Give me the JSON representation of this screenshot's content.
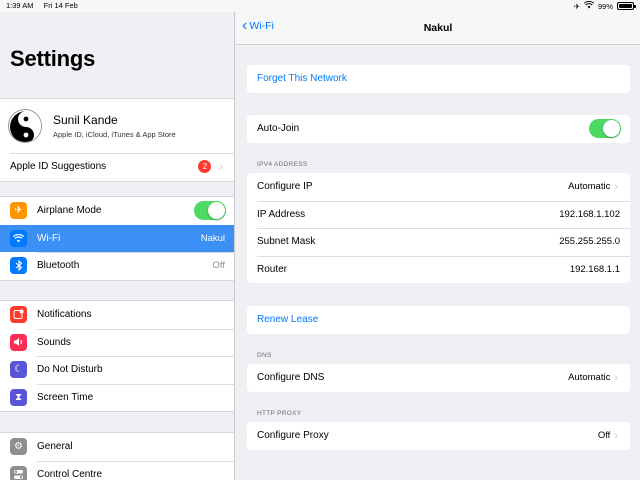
{
  "status": {
    "time": "1:39 AM",
    "date": "Fri 14 Feb",
    "battery": "99%"
  },
  "left": {
    "title": "Settings",
    "profile": {
      "name": "Sunil Kande",
      "subtitle": "Apple ID, iCloud, iTunes & App Store"
    },
    "suggestions": {
      "label": "Apple ID Suggestions",
      "badge": "2"
    },
    "connectivity": [
      {
        "label": "Airplane Mode",
        "icon": "airplane-icon",
        "color": "#ff9500"
      },
      {
        "label": "Wi-Fi",
        "value": "Nakul",
        "icon": "wifi-icon",
        "color": "#007aff"
      },
      {
        "label": "Bluetooth",
        "value": "Off",
        "icon": "bluetooth-icon",
        "color": "#007aff"
      }
    ],
    "notifications": [
      {
        "label": "Notifications",
        "icon": "notifications-icon",
        "color": "#ff3b30"
      },
      {
        "label": "Sounds",
        "icon": "sounds-icon",
        "color": "#ff2d55"
      },
      {
        "label": "Do Not Disturb",
        "icon": "moon-icon",
        "color": "#5856d6"
      },
      {
        "label": "Screen Time",
        "icon": "hourglass-icon",
        "color": "#5856d6"
      }
    ],
    "general": [
      {
        "label": "General",
        "icon": "gear-icon",
        "color": "#8e8e93"
      },
      {
        "label": "Control Centre",
        "icon": "control-centre-icon",
        "color": "#8e8e93"
      }
    ]
  },
  "right": {
    "back_label": "Wi-Fi",
    "title": "Nakul",
    "forget": "Forget This Network",
    "auto_join": "Auto-Join",
    "ipv4_header": "IPV4 ADDRESS",
    "configure_ip": {
      "label": "Configure IP",
      "value": "Automatic"
    },
    "ip_address": {
      "label": "IP Address",
      "value": "192.168.1.102"
    },
    "subnet": {
      "label": "Subnet Mask",
      "value": "255.255.255.0"
    },
    "router": {
      "label": "Router",
      "value": "192.168.1.1"
    },
    "renew": "Renew Lease",
    "dns_header": "DNS",
    "configure_dns": {
      "label": "Configure DNS",
      "value": "Automatic"
    },
    "proxy_header": "HTTP PROXY",
    "configure_proxy": {
      "label": "Configure Proxy",
      "value": "Off"
    }
  }
}
